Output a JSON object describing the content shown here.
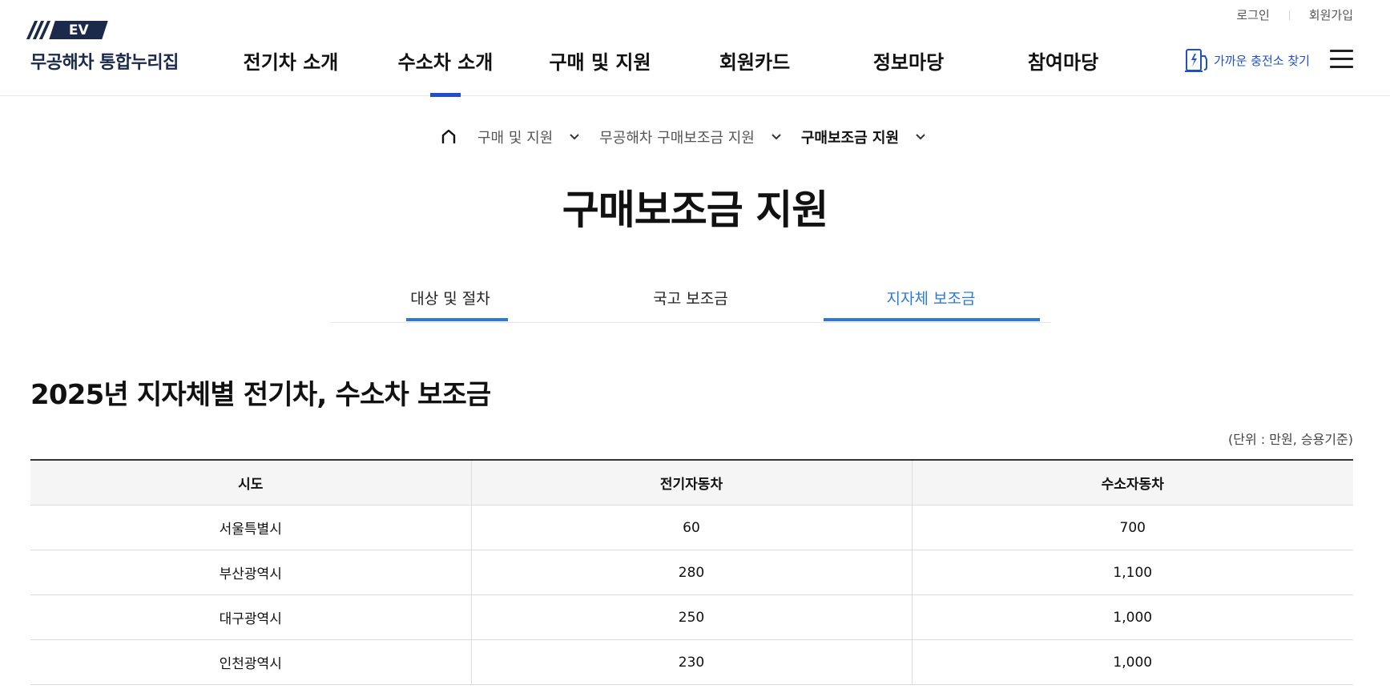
{
  "util_links": {
    "login": "로그인",
    "signup": "회원가입"
  },
  "logo": {
    "badge": "EV",
    "site_name": "무공해차 통합누리집"
  },
  "gnb": {
    "items": [
      {
        "label": "전기차 소개"
      },
      {
        "label": "수소차 소개"
      },
      {
        "label": "구매 및 지원"
      },
      {
        "label": "회원카드"
      },
      {
        "label": "정보마당"
      },
      {
        "label": "참여마당"
      }
    ],
    "active_index": 1
  },
  "charger_link": {
    "label": "가까운 충전소 찾기",
    "icon": "charger-icon"
  },
  "breadcrumb": {
    "home_icon": "home-icon",
    "items": [
      {
        "label": "구매 및 지원"
      },
      {
        "label": "무공해차 구매보조금 지원"
      },
      {
        "label": "구매보조금 지원"
      }
    ]
  },
  "page_title": "구매보조금 지원",
  "tabs": [
    {
      "label": "대상 및 절차"
    },
    {
      "label": "국고 보조금"
    },
    {
      "label": "지자체 보조금"
    }
  ],
  "active_tab": "지자체 보조금",
  "section_title": "2025년 지자체별 전기차, 수소차 보조금",
  "unit_note": "(단위 : 만원, 승용기준)",
  "table": {
    "headers": [
      "시도",
      "전기자동차",
      "수소자동차"
    ],
    "rows": [
      [
        "서울특별시",
        "60",
        "700"
      ],
      [
        "부산광역시",
        "280",
        "1,100"
      ],
      [
        "대구광역시",
        "250",
        "1,000"
      ],
      [
        "인천광역시",
        "230",
        "1,000"
      ]
    ]
  },
  "colors": {
    "brand_navy": "#1b2a4a",
    "accent_blue": "#1f4fc9",
    "tab_blue": "#2b7bd6"
  }
}
